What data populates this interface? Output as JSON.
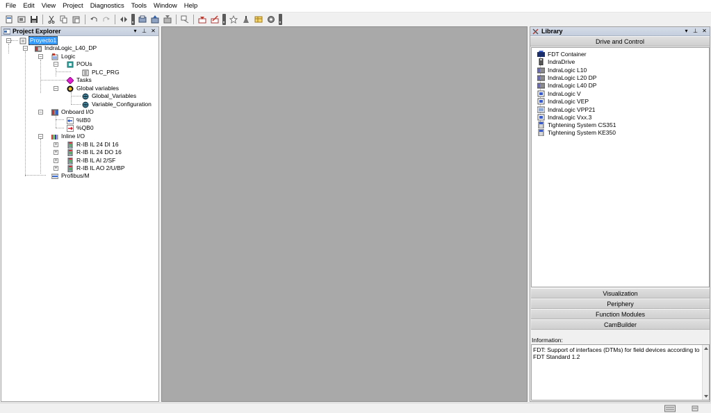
{
  "menu": {
    "items": [
      "File",
      "Edit",
      "View",
      "Project",
      "Diagnostics",
      "Tools",
      "Window",
      "Help"
    ]
  },
  "project_explorer": {
    "title": "Project Explorer",
    "tree": {
      "root": "Proyecto1",
      "controller": "IndraLogic_L40_DP",
      "logic": "Logic",
      "pous": "POUs",
      "plc_prg": "PLC_PRG",
      "tasks": "Tasks",
      "global_variables": "Global variables",
      "global_variables_item": "Global_Variables",
      "variable_configuration": "Variable_Configuration",
      "onboard_io": "Onboard I/O",
      "ib0": "%IB0",
      "qb0": "%QB0",
      "inline_io": "Inline I/O",
      "inline_items": [
        "R-IB IL 24 DI 16",
        "R-IB IL 24 DO 16",
        "R-IB IL AI 2/SF",
        "R-IB IL AO 2/U/BP"
      ],
      "profibus": "Profibus/M"
    }
  },
  "library": {
    "title": "Library",
    "active_section": "Drive and Control",
    "items": [
      "FDT Container",
      "IndraDrive",
      "IndraLogic L10",
      "IndraLogic L20 DP",
      "IndraLogic L40 DP",
      "IndraLogic V",
      "IndraLogic VEP",
      "IndraLogic VPP21",
      "IndraLogic Vxx.3",
      "Tightening System CS351",
      "Tightening System KE350"
    ],
    "sections": [
      "Visualization",
      "Periphery",
      "Function Modules",
      "CamBuilder"
    ],
    "information_label": "Information:",
    "information_text": "FDT: Support of interfaces (DTMs) for field devices according to FDT Standard 1.2"
  },
  "colors": {
    "selection": "#3399ff",
    "editor_background": "#a9a9a9",
    "panel_title": "#c4cedd"
  }
}
